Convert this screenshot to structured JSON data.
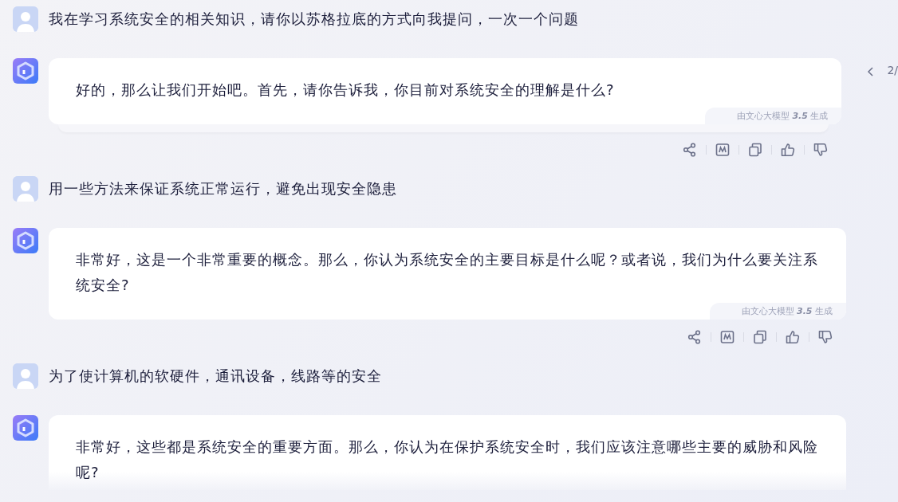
{
  "messages": [
    {
      "kind": "user",
      "text": "我在学习系统安全的相关知识，请你以苏格拉底的方式向我提问，一次一个问题"
    },
    {
      "kind": "bot",
      "text": "好的，那么让我们开始吧。首先，请你告诉我，你目前对系统安全的理解是什么?",
      "footer": "由文心大模型 **3.5** 生成",
      "stacked": true,
      "pager": {
        "text": "2/"
      },
      "actions": true,
      "faded": false
    },
    {
      "kind": "user",
      "text": "用一些方法来保证系统正常运行，避免出现安全隐患"
    },
    {
      "kind": "bot",
      "text": "非常好，这是一个非常重要的概念。那么，你认为系统安全的主要目标是什么呢？或者说，我们为什么要关注系统安全?",
      "footer": "由文心大模型 **3.5** 生成",
      "stacked": false,
      "actions": true,
      "faded": false
    },
    {
      "kind": "user",
      "text": "为了使计算机的软硬件，通讯设备，线路等的安全"
    },
    {
      "kind": "bot",
      "text": "非常好，这些都是系统安全的重要方面。那么，你认为在保护系统安全时，我们应该注意哪些主要的威胁和风险呢?",
      "stacked": false,
      "actions": false,
      "faded": true
    }
  ]
}
